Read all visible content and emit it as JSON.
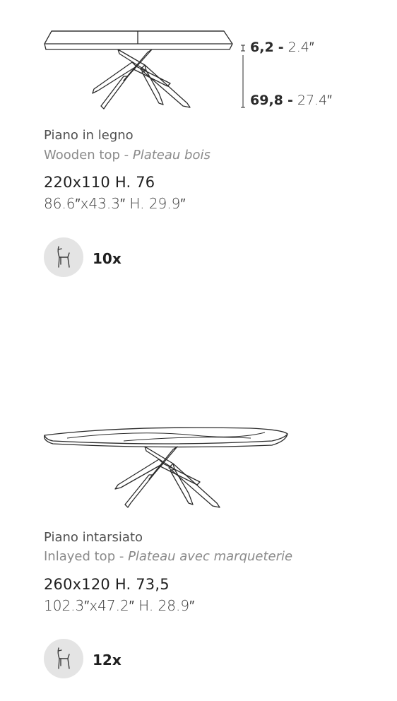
{
  "products": [
    {
      "dimensions": {
        "top_thickness_metric": "6,2",
        "top_thickness_imperial": "2.4″",
        "height_metric": "69,8",
        "height_imperial": "27.4″",
        "separator": "-"
      },
      "title": "Piano in legno",
      "subtitle_en": "Wooden top - ",
      "subtitle_fr": "Plateau bois",
      "size_metric": "220x110  H. 76",
      "size_imperial": "86.6″x43.3″  H. 29.9″",
      "chair_icon": "chair-icon",
      "seats": "10x"
    },
    {
      "title": "Piano intarsiato",
      "subtitle_en": "Inlayed top - ",
      "subtitle_fr": "Plateau avec marqueterie",
      "size_metric": "260x120  H. 73,5",
      "size_imperial": "102.3″x47.2″  H. 28.9″",
      "chair_icon": "chair-icon",
      "seats": "12x"
    }
  ]
}
